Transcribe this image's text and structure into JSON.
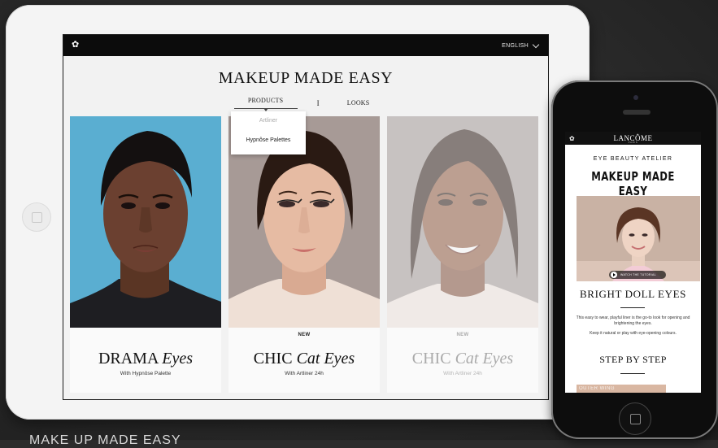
{
  "tablet": {
    "language": "ENGLISH",
    "title": "MAKEUP MADE EASY",
    "nav": {
      "products": "PRODUCTS",
      "separator": "I",
      "looks": "LOOKS"
    },
    "dropdown": [
      "Artliner",
      "Hypnôse Palettes"
    ],
    "cards": [
      {
        "badge": "",
        "title_main": "DRAMA",
        "title_italic": "Eyes",
        "subtitle": "With Hypnôse Palette"
      },
      {
        "badge": "NEW",
        "title_main": "CHIC",
        "title_italic": "Cat Eyes",
        "subtitle": "With Artliner 24h"
      },
      {
        "badge": "NEW",
        "title_main": "CHIC",
        "title_italic": "Cat Eyes",
        "subtitle": "With Artliner 24h"
      }
    ]
  },
  "phone": {
    "brand": "LANCÔME",
    "brand_sub": "PARIS",
    "kicker": "EYE BEAUTY ATELIER",
    "title": "MAKEUP MADE EASY",
    "video_button": "WATCH THE TUTORIAL",
    "look_title": "BRIGHT DOLL EYES",
    "para1": "This easy to wear, playful liner is the go-to look for opening and brightening the eyes.",
    "para2": "Keep it natural or play with eye-opening colours.",
    "step_title": "STEP BY STEP",
    "strip_label": "OUTER WING"
  },
  "caption": "MAKE UP MADE EASY"
}
